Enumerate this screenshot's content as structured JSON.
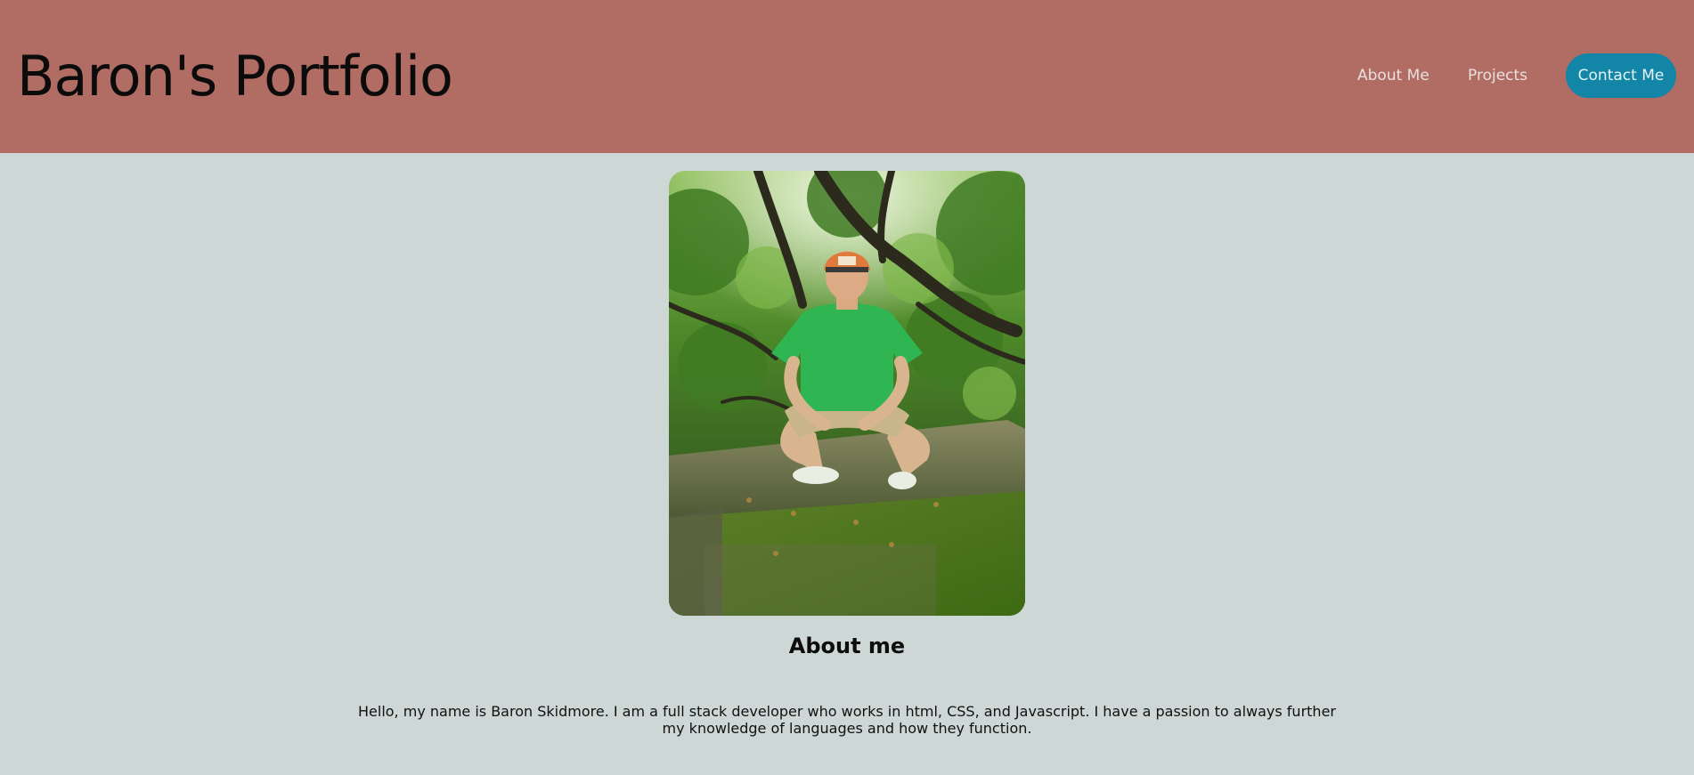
{
  "header": {
    "title": "Baron's Portfolio",
    "background_color": "#b16c63"
  },
  "nav": {
    "items": [
      {
        "label": "About Me"
      },
      {
        "label": "Projects"
      },
      {
        "label": "Contact Me",
        "accent_color": "#1385a6"
      }
    ]
  },
  "main": {
    "photo": {
      "subject": "portrait-photo"
    },
    "heading": "About me",
    "bio": "Hello, my name is Baron Skidmore. I am a full stack developer who works in html, CSS, and Javascript. I have a passion to always further my knowledge of languages and how they function."
  },
  "page": {
    "background_color": "#ccd7d6"
  }
}
